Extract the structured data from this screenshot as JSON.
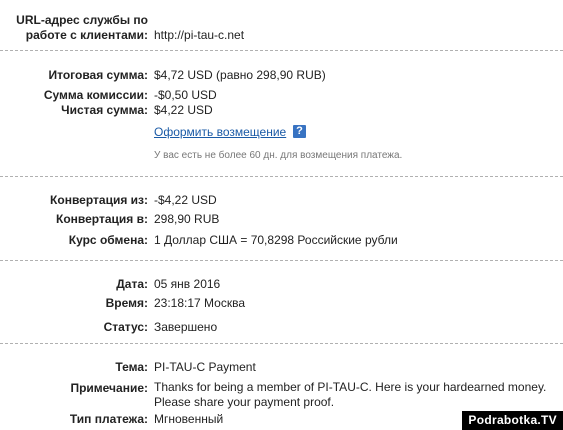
{
  "service": {
    "label": "URL-адрес службы по работе с клиентами:",
    "label_line1": "URL-адрес службы по",
    "label_line2": "работе с клиентами:",
    "value": "http://pi-tau-c.net"
  },
  "summary": {
    "total_label": "Итоговая сумма:",
    "total_value": "$4,72 USD (равно 298,90 RUB)",
    "fee_label": "Сумма комиссии:",
    "fee_value": "-$0,50 USD",
    "net_label": "Чистая сумма:",
    "net_value": "$4,22 USD",
    "refund_link": "Оформить возмещение",
    "help_icon": "?",
    "refund_note": "У вас есть не более 60 дн. для возмещения платежа."
  },
  "conversion": {
    "from_label": "Конвертация из:",
    "from_value": "-$4,22 USD",
    "to_label": "Конвертация в:",
    "to_value": "298,90 RUB",
    "rate_label": "Курс обмена:",
    "rate_value": "1 Доллар США = 70,8298 Российские рубли"
  },
  "status_block": {
    "date_label": "Дата:",
    "date_value": "05 янв 2016",
    "time_label": "Время:",
    "time_value": "23:18:17 Москва",
    "status_label": "Статус:",
    "status_value": "Завершено"
  },
  "details": {
    "subject_label": "Тема:",
    "subject_value": "PI-TAU-C Payment",
    "note_label": "Примечание:",
    "note_line1": "Thanks for being a member of PI-TAU-C. Here is your hardearned money.",
    "note_line2": "Please share your payment proof.",
    "type_label": "Тип платежа:",
    "type_value": "Мгновенный"
  },
  "watermark": "Podrabotka.TV",
  "colors": {
    "link": "#1a5aa6",
    "help_icon_bg": "#3873c2",
    "separator": "#b0b0b0",
    "note": "#777777"
  }
}
